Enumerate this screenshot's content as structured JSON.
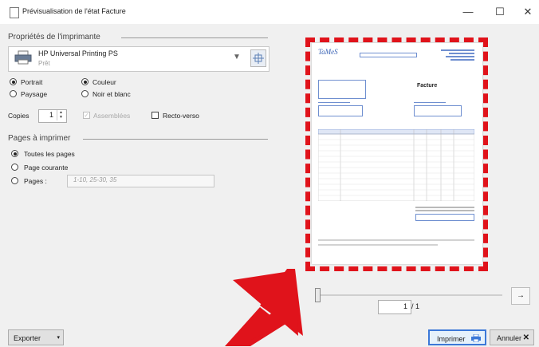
{
  "window": {
    "title": "Prévisualisation de l'état Facture",
    "minimize": "—",
    "maximize": "☐",
    "close": "✕"
  },
  "printer_section": {
    "label": "Propriétés de l'imprimante",
    "printer_name": "HP Universal Printing PS",
    "printer_status": "Prêt"
  },
  "orientation": {
    "portrait": "Portrait",
    "landscape": "Paysage",
    "selected": "Portrait"
  },
  "color": {
    "color": "Couleur",
    "bw": "Noir et blanc",
    "selected": "Couleur"
  },
  "copies": {
    "label": "Copies",
    "value": "1",
    "collate": "Assemblées",
    "duplex": "Recto-verso"
  },
  "pages_section": {
    "label": "Pages à imprimer",
    "all": "Toutes les pages",
    "current": "Page courante",
    "range": "Pages :",
    "range_placeholder": "1-10, 25-30, 35"
  },
  "preview": {
    "page_current": "1",
    "page_total": "/ 1",
    "next_icon": "→",
    "document": {
      "logo": "TaMeS",
      "heading": "Facture"
    }
  },
  "footer": {
    "export": "Exporter",
    "export_arrow": "▾",
    "print": "Imprimer",
    "cancel": "Annuler",
    "cancel_icon": "✕"
  },
  "colors": {
    "annotation_red": "#e0131b",
    "accent_blue": "#3b78d8"
  }
}
